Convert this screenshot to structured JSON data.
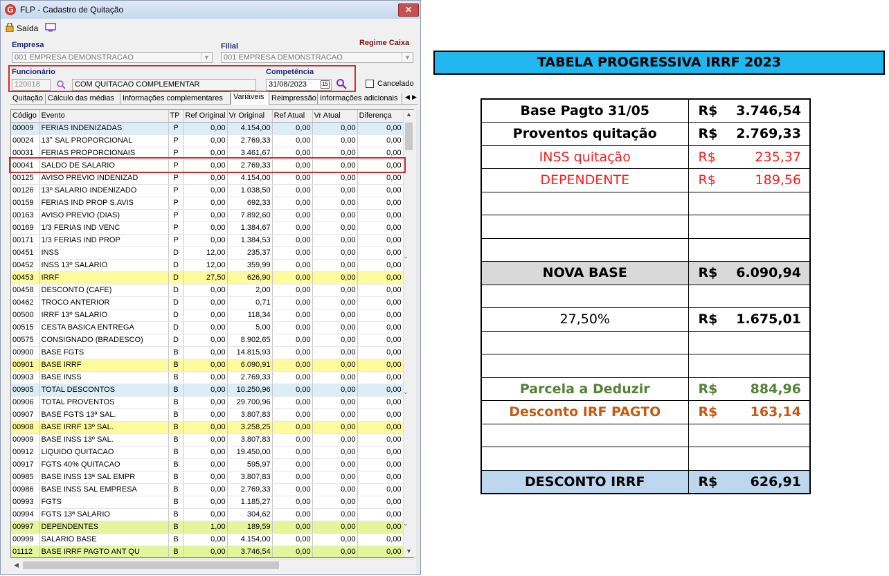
{
  "window": {
    "title": "FLP - Cadastro de Quitação",
    "close_label": "✕",
    "toolbar": {
      "exit_label": "Saída"
    }
  },
  "form": {
    "empresa_label": "Empresa",
    "empresa_value": "001 EMPRESA DEMONSTRACAO",
    "filial_label": "Filial",
    "filial_value": "001 EMPRESA DEMONSTRACAO",
    "regime_label": "Regime Caixa",
    "funcionario_label": "Funcionário",
    "funcionario_code": "120018",
    "funcionario_name": "COM QUITACAO COMPLEMENTAR",
    "competencia_label": "Competência",
    "competencia_value": "31/08/2023",
    "cancelado_label": "Cancelado"
  },
  "tabs": [
    "Quitação",
    "Cálculo das médias",
    "Informações complementares",
    "Variáveis",
    "Reimpressão",
    "Informações adicionais"
  ],
  "grid": {
    "columns": [
      "Código",
      "Evento",
      "TP",
      "Ref Original",
      "Vr Original",
      "Ref Atual",
      "Vr Atual",
      "Diferença"
    ],
    "rows": [
      {
        "hl": "blue",
        "c": [
          "00009",
          "FERIAS INDENIZADAS",
          "P",
          "0,00",
          "4.154,00",
          "0,00",
          "0,00",
          "0,00"
        ]
      },
      {
        "hl": "",
        "c": [
          "00024",
          "13° SAL PROPORCIONAL",
          "P",
          "0,00",
          "2.769,33",
          "0,00",
          "0,00",
          "0,00"
        ]
      },
      {
        "hl": "",
        "c": [
          "00031",
          "FERIAS PROPORCIONAIS",
          "P",
          "0,00",
          "3.461,67",
          "0,00",
          "0,00",
          "0,00"
        ]
      },
      {
        "hl": "",
        "c": [
          "00041",
          "SALDO DE SALARIO",
          "P",
          "0,00",
          "2.769,33",
          "0,00",
          "0,00",
          "0,00"
        ]
      },
      {
        "hl": "",
        "c": [
          "00125",
          "AVISO PREVIO INDENIZAD",
          "P",
          "0,00",
          "4.154,00",
          "0,00",
          "0,00",
          "0,00"
        ]
      },
      {
        "hl": "",
        "c": [
          "00126",
          "13º SALARIO INDENIZADO",
          "P",
          "0,00",
          "1.038,50",
          "0,00",
          "0,00",
          "0,00"
        ]
      },
      {
        "hl": "",
        "c": [
          "00159",
          "FERIAS IND PROP S.AVIS",
          "P",
          "0,00",
          "692,33",
          "0,00",
          "0,00",
          "0,00"
        ]
      },
      {
        "hl": "",
        "c": [
          "00163",
          "AVISO PREVIO (DIAS)",
          "P",
          "0,00",
          "7.892,60",
          "0,00",
          "0,00",
          "0,00"
        ]
      },
      {
        "hl": "",
        "c": [
          "00169",
          "1/3 FERIAS IND VENC",
          "P",
          "0,00",
          "1.384,67",
          "0,00",
          "0,00",
          "0,00"
        ]
      },
      {
        "hl": "",
        "c": [
          "00171",
          "1/3 FERIAS IND PROP",
          "P",
          "0,00",
          "1.384,53",
          "0,00",
          "0,00",
          "0,00"
        ]
      },
      {
        "hl": "",
        "c": [
          "00451",
          "INSS",
          "D",
          "12,00",
          "235,37",
          "0,00",
          "0,00",
          "0,00"
        ]
      },
      {
        "hl": "",
        "c": [
          "00452",
          "INSS 13º SALARIO",
          "D",
          "12,00",
          "359,99",
          "0,00",
          "0,00",
          "0,00"
        ]
      },
      {
        "hl": "yellow",
        "c": [
          "00453",
          "IRRF",
          "D",
          "27,50",
          "626,90",
          "0,00",
          "0,00",
          "0,00"
        ]
      },
      {
        "hl": "",
        "c": [
          "00458",
          "DESCONTO (CAFE)",
          "D",
          "0,00",
          "2,00",
          "0,00",
          "0,00",
          "0,00"
        ]
      },
      {
        "hl": "",
        "c": [
          "00462",
          "TROCO ANTERIOR",
          "D",
          "0,00",
          "0,71",
          "0,00",
          "0,00",
          "0,00"
        ]
      },
      {
        "hl": "",
        "c": [
          "00500",
          "IRRF 13º SALARIO",
          "D",
          "0,00",
          "118,34",
          "0,00",
          "0,00",
          "0,00"
        ]
      },
      {
        "hl": "",
        "c": [
          "00515",
          "CESTA BASICA ENTREGA",
          "D",
          "0,00",
          "5,00",
          "0,00",
          "0,00",
          "0,00"
        ]
      },
      {
        "hl": "",
        "c": [
          "00575",
          "CONSIGNADO (BRADESCO)",
          "D",
          "0,00",
          "8.902,65",
          "0,00",
          "0,00",
          "0,00"
        ]
      },
      {
        "hl": "",
        "c": [
          "00900",
          "BASE FGTS",
          "B",
          "0,00",
          "14.815,93",
          "0,00",
          "0,00",
          "0,00"
        ]
      },
      {
        "hl": "yellow",
        "c": [
          "00901",
          "BASE IRRF",
          "B",
          "0,00",
          "6.090,91",
          "0,00",
          "0,00",
          "0,00"
        ]
      },
      {
        "hl": "",
        "c": [
          "00903",
          "BASE INSS",
          "B",
          "0,00",
          "2.769,33",
          "0,00",
          "0,00",
          "0,00"
        ]
      },
      {
        "hl": "blue",
        "c": [
          "00905",
          "TOTAL DESCONTOS",
          "B",
          "0,00",
          "10.250,96",
          "0,00",
          "0,00",
          "0,00"
        ]
      },
      {
        "hl": "",
        "c": [
          "00906",
          "TOTAL PROVENTOS",
          "B",
          "0,00",
          "29.700,96",
          "0,00",
          "0,00",
          "0,00"
        ]
      },
      {
        "hl": "",
        "c": [
          "00907",
          "BASE FGTS 13ª SAL.",
          "B",
          "0,00",
          "3.807,83",
          "0,00",
          "0,00",
          "0,00"
        ]
      },
      {
        "hl": "yellow",
        "c": [
          "00908",
          "BASE IRRF 13º SAL.",
          "B",
          "0,00",
          "3.258,25",
          "0,00",
          "0,00",
          "0,00"
        ]
      },
      {
        "hl": "",
        "c": [
          "00909",
          "BASE INSS 13º SAL.",
          "B",
          "0,00",
          "3.807,83",
          "0,00",
          "0,00",
          "0,00"
        ]
      },
      {
        "hl": "",
        "c": [
          "00912",
          "LIQUIDO QUITACAO",
          "B",
          "0,00",
          "19.450,00",
          "0,00",
          "0,00",
          "0,00"
        ]
      },
      {
        "hl": "",
        "c": [
          "00917",
          "FGTS 40% QUITACAO",
          "B",
          "0,00",
          "595,97",
          "0,00",
          "0,00",
          "0,00"
        ]
      },
      {
        "hl": "",
        "c": [
          "00985",
          "BASE INSS 13ª SAL EMPR",
          "B",
          "0,00",
          "3.807,83",
          "0,00",
          "0,00",
          "0,00"
        ]
      },
      {
        "hl": "",
        "c": [
          "00986",
          "BASE INSS SAL EMPRESA",
          "B",
          "0,00",
          "2.769,33",
          "0,00",
          "0,00",
          "0,00"
        ]
      },
      {
        "hl": "",
        "c": [
          "00993",
          "FGTS",
          "B",
          "0,00",
          "1.185,27",
          "0,00",
          "0,00",
          "0,00"
        ]
      },
      {
        "hl": "",
        "c": [
          "00994",
          "FGTS 13ª SALARIO",
          "B",
          "0,00",
          "304,62",
          "0,00",
          "0,00",
          "0,00"
        ]
      },
      {
        "hl": "green",
        "c": [
          "00997",
          "DEPENDENTES",
          "B",
          "1,00",
          "189,59",
          "0,00",
          "0,00",
          "0,00"
        ]
      },
      {
        "hl": "",
        "c": [
          "00999",
          "SALARIO BASE",
          "B",
          "0,00",
          "4.154,00",
          "0,00",
          "0,00",
          "0,00"
        ]
      },
      {
        "hl": "green",
        "c": [
          "01112",
          "BASE IRRF PAGTO ANT QU",
          "B",
          "0,00",
          "3.746,54",
          "0,00",
          "0,00",
          "0,00"
        ]
      }
    ]
  },
  "irrf_table": {
    "title": "TABELA PROGRESSIVA IRRF 2023",
    "currency": "R$",
    "rows": [
      {
        "label": "Base Pagto 31/05",
        "cur": "R$",
        "value": "3.746,54",
        "style": "b",
        "bg": ""
      },
      {
        "label": "Proventos quitação",
        "cur": "R$",
        "value": "2.769,33",
        "style": "b",
        "bg": ""
      },
      {
        "label": "INSS quitação",
        "cur": "R$",
        "value": "235,37",
        "style": "red",
        "bg": ""
      },
      {
        "label": "DEPENDENTE",
        "cur": "R$",
        "value": "189,56",
        "style": "red",
        "bg": ""
      },
      {
        "label": "",
        "cur": "",
        "value": "",
        "style": "",
        "bg": ""
      },
      {
        "label": "",
        "cur": "",
        "value": "",
        "style": "",
        "bg": ""
      },
      {
        "label": "",
        "cur": "",
        "value": "",
        "style": "",
        "bg": ""
      },
      {
        "label": "NOVA BASE",
        "cur": "R$",
        "value": "6.090,94",
        "style": "b",
        "bg": "gray"
      },
      {
        "label": "",
        "cur": "",
        "value": "",
        "style": "",
        "bg": ""
      },
      {
        "label": "27,50%",
        "cur": "R$",
        "value": "1.675,01",
        "style": "pct",
        "bg": ""
      },
      {
        "label": "",
        "cur": "",
        "value": "",
        "style": "",
        "bg": ""
      },
      {
        "label": "",
        "cur": "",
        "value": "",
        "style": "",
        "bg": ""
      },
      {
        "label": "Parcela a Deduzir",
        "cur": "R$",
        "value": "884,96",
        "style": "b green",
        "bg": ""
      },
      {
        "label": "Desconto IRF PAGTO",
        "cur": "R$",
        "value": "163,14",
        "style": "b orange",
        "bg": ""
      },
      {
        "label": "",
        "cur": "",
        "value": "",
        "style": "",
        "bg": ""
      },
      {
        "label": "",
        "cur": "",
        "value": "",
        "style": "",
        "bg": ""
      },
      {
        "label": "DESCONTO IRRF",
        "cur": "R$",
        "value": "626,91",
        "style": "b",
        "bg": "lblue"
      }
    ]
  }
}
